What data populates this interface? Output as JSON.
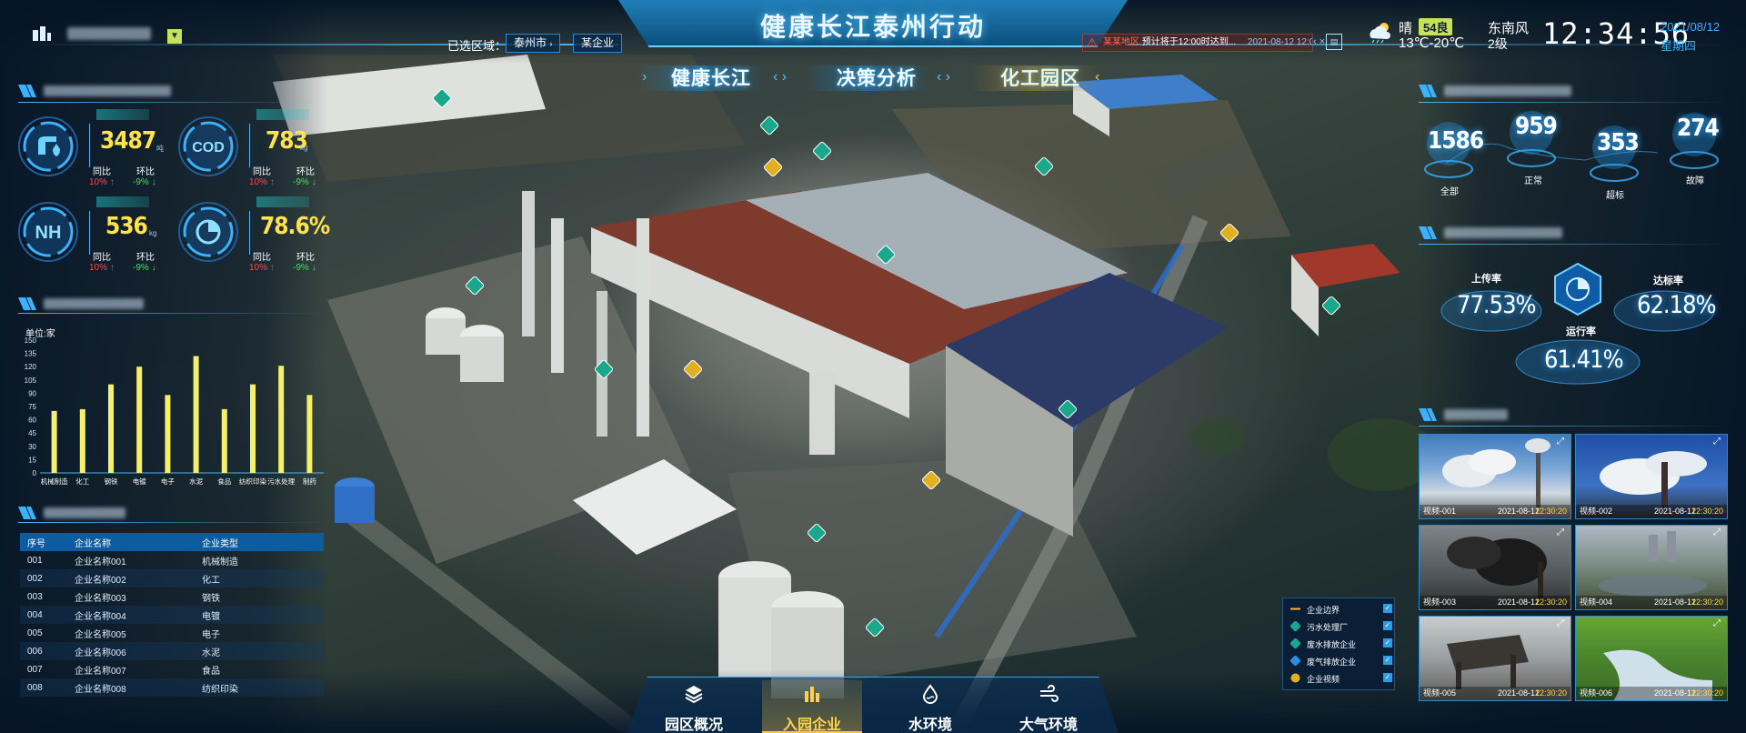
{
  "header": {
    "title": "健康长江泰州行动",
    "region_label": "已选区域：",
    "city": "泰州市",
    "company": "某企业",
    "alert": {
      "area": "某某地区",
      "message": "预计将于12:00时达到...",
      "time": "2021-08-12 12:00",
      "controls": "‹ ×"
    },
    "sub_icon": "subtitles-icon",
    "weather": {
      "icon": "cloud-sun-icon",
      "condition": "晴",
      "aqi": "54良",
      "temperature": "13℃-20℃",
      "wind_direction": "东南风",
      "wind_level": "2级"
    },
    "time": "12:34:56",
    "date": "2021/08/12",
    "weekday": "星期四"
  },
  "nav": {
    "items": [
      "健康长江",
      "决策分析",
      "化工园区"
    ],
    "separator": "‹ ›"
  },
  "left": {
    "kpis": [
      {
        "icon": "water-tap-icon",
        "value": "3487",
        "unit": "吨",
        "yoy_label": "同比",
        "mom_label": "环比",
        "yoy": "10%",
        "mom": "-9%"
      },
      {
        "icon": "cod-icon",
        "icon_text": "COD",
        "value": "783",
        "unit": "kg",
        "yoy_label": "同比",
        "mom_label": "环比",
        "yoy": "10%",
        "mom": "-9%"
      },
      {
        "icon": "nh-icon",
        "icon_text": "NH",
        "value": "536",
        "unit": "kg",
        "yoy_label": "同比",
        "mom_label": "环比",
        "yoy": "10%",
        "mom": "-9%"
      },
      {
        "icon": "pie-chart-icon",
        "value": "78.6%",
        "unit": "",
        "yoy_label": "同比",
        "mom_label": "环比",
        "yoy": "10%",
        "mom": "-9%"
      }
    ],
    "chart_unit": "单位:家",
    "table": {
      "headers": [
        "序号",
        "企业名称",
        "企业类型"
      ],
      "rows": [
        [
          "001",
          "企业名称001",
          "机械制造"
        ],
        [
          "002",
          "企业名称002",
          "化工"
        ],
        [
          "003",
          "企业名称003",
          "钢铁"
        ],
        [
          "004",
          "企业名称004",
          "电镀"
        ],
        [
          "005",
          "企业名称005",
          "电子"
        ],
        [
          "006",
          "企业名称006",
          "水泥"
        ],
        [
          "007",
          "企业名称007",
          "食品"
        ],
        [
          "008",
          "企业名称008",
          "纺织印染"
        ]
      ]
    }
  },
  "chart_data": {
    "type": "bar",
    "categories": [
      "机械制造",
      "化工",
      "钢铁",
      "电镀",
      "电子",
      "水泥",
      "食品",
      "纺织印染",
      "污水处理",
      "制药"
    ],
    "values": [
      70,
      72,
      100,
      120,
      88,
      132,
      72,
      100,
      121,
      88
    ],
    "ylim": [
      0,
      150
    ],
    "yticks": [
      0,
      15,
      30,
      45,
      60,
      75,
      90,
      105,
      120,
      135,
      150
    ],
    "ylabel": "单位:家",
    "bar_color": "#f4f06a",
    "grid": false
  },
  "right": {
    "stats": [
      {
        "value": "1586",
        "label": "全部"
      },
      {
        "value": "959",
        "label": "正常"
      },
      {
        "value": "353",
        "label": "超标"
      },
      {
        "value": "274",
        "label": "故障"
      }
    ],
    "rates": [
      {
        "label": "上传率",
        "value": "77.53%"
      },
      {
        "label": "达标率",
        "value": "62.18%"
      },
      {
        "label": "运行率",
        "value": "61.41%"
      }
    ],
    "videos": [
      {
        "name": "视频-001",
        "date": "2021-08-12",
        "time": "12:30:20"
      },
      {
        "name": "视频-002",
        "date": "2021-08-12",
        "time": "12:30:20"
      },
      {
        "name": "视频-003",
        "date": "2021-08-12",
        "time": "12:30:20"
      },
      {
        "name": "视频-004",
        "date": "2021-08-12",
        "time": "12:30:20"
      },
      {
        "name": "视频-005",
        "date": "2021-08-12",
        "time": "12:30:20"
      },
      {
        "name": "视频-006",
        "date": "2021-08-12",
        "time": "12:30:20"
      }
    ]
  },
  "legend": {
    "items": [
      {
        "label": "企业边界",
        "icon": "boundary-line-icon",
        "checked": "✓"
      },
      {
        "label": "污水处理厂",
        "icon": "sewage-plant-icon",
        "checked": "✓"
      },
      {
        "label": "废水排放企业",
        "icon": "wastewater-icon",
        "checked": "✓"
      },
      {
        "label": "废气排放企业",
        "icon": "exhaust-gas-icon",
        "checked": "✓"
      },
      {
        "label": "企业视频",
        "icon": "camera-icon",
        "checked": "✓"
      }
    ]
  },
  "bottom_nav": {
    "tabs": [
      {
        "label": "园区概况",
        "icon": "layers-icon"
      },
      {
        "label": "入园企业",
        "icon": "enterprise-icon"
      },
      {
        "label": "水环境",
        "icon": "water-drop-icon"
      },
      {
        "label": "大气环境",
        "icon": "wind-icon"
      }
    ],
    "active": "入园企业"
  },
  "colors": {
    "accent": "#3ab2ff",
    "highlight": "#ffe34a",
    "up": "#ff4a4a",
    "down": "#3fe05a",
    "active_tab": "#ffd24a"
  }
}
